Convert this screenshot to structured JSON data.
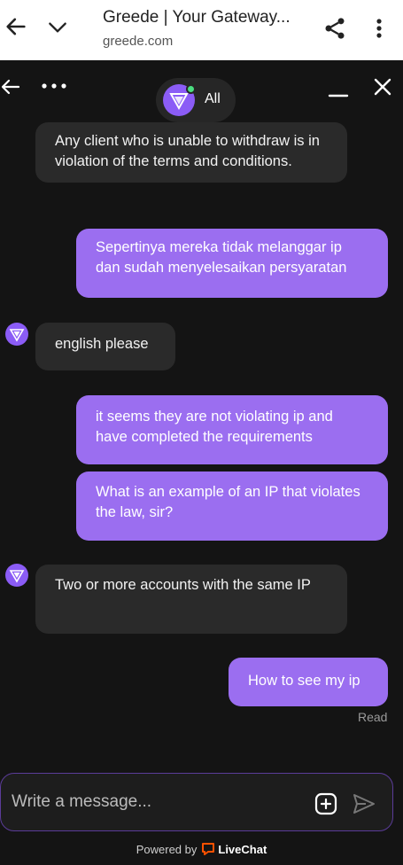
{
  "browser": {
    "title": "Greede | Your Gateway...",
    "url": "greede.com"
  },
  "header": {
    "agent_name": "All"
  },
  "messages": [
    {
      "from": "agent",
      "text": "Any client who is unable to withdraw is in violation of the terms and conditions."
    },
    {
      "from": "user",
      "text": "Sepertinya mereka tidak melanggar ip dan sudah menyelesaikan persyaratan"
    },
    {
      "from": "agent",
      "text": "english please"
    },
    {
      "from": "user",
      "text": "it seems they are not violating ip and have completed the requirements"
    },
    {
      "from": "user",
      "text": "What is an example of an IP that violates the law, sir?"
    },
    {
      "from": "agent",
      "text": "Two or more accounts with the same IP"
    },
    {
      "from": "user",
      "text": "How to see my ip"
    }
  ],
  "read_status": "Read",
  "composer": {
    "placeholder": "Write a message..."
  },
  "footer": {
    "powered_by": "Powered by",
    "brand": "LiveChat"
  },
  "colors": {
    "background": "#141414",
    "agent_bubble": "#2a2a2a",
    "user_bubble": "#9b6ef0",
    "accent": "#8b5cf6",
    "online": "#4ade80",
    "livechat": "#ff5100"
  }
}
